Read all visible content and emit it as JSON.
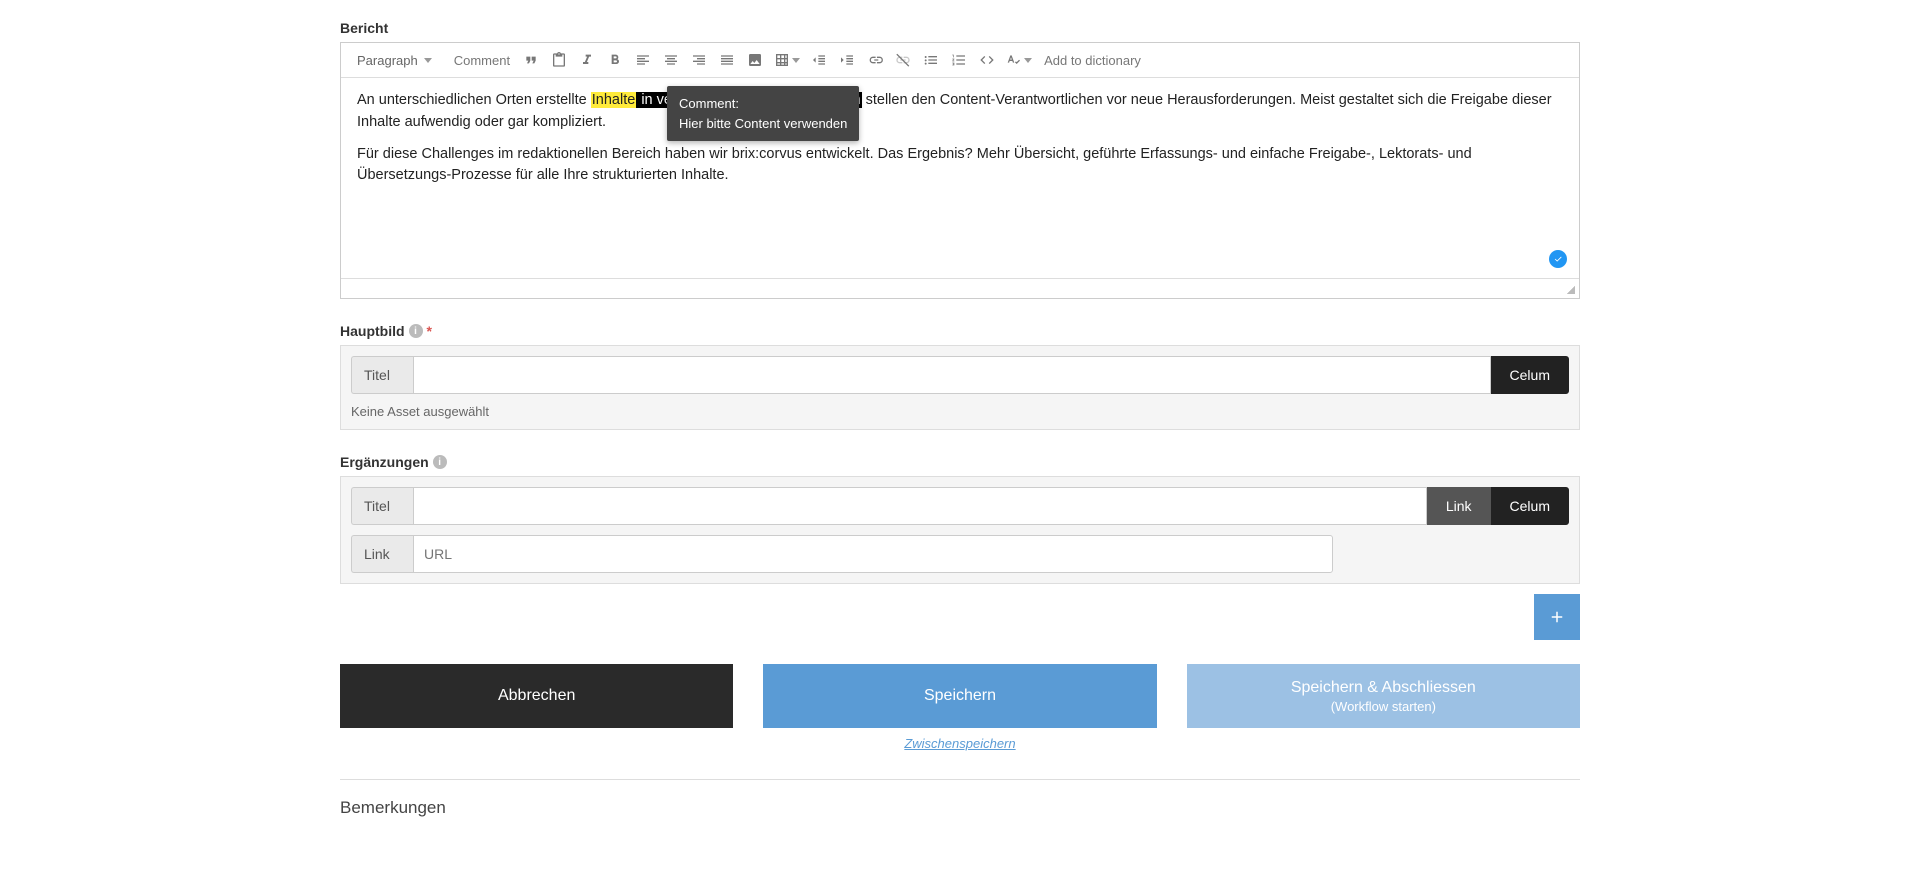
{
  "labels": {
    "bericht": "Bericht",
    "hauptbild": "Hauptbild",
    "erganzungen": "Ergänzungen",
    "bemerkungen": "Bemerkungen"
  },
  "toolbar": {
    "paragraph": "Paragraph",
    "comment": "Comment",
    "add_dict": "Add to dictionary"
  },
  "editor": {
    "p1_a": "An unterschiedlichen Orten erstellte ",
    "p1_hl": "Inhalte",
    "p1_b": " in verschiedenen Sprachvarianten",
    "p1_c": " stellen den Content-Verantwortlichen vor neue Herausforderungen. Meist gestaltet sich die Freigabe dieser Inhalte aufwendig oder gar kompliziert.",
    "p2": "Für diese Challenges im redaktionellen Bereich haben wir brix:corvus entwickelt. Das Ergebnis? Mehr Übersicht, geführte Erfassungs- und einfache Freigabe-, Lektorats- und Übersetzungs-Prozesse für alle Ihre strukturierten Inhalte."
  },
  "tooltip": {
    "line1": "Comment:",
    "line2": "Hier bitte Content verwenden"
  },
  "hauptbild": {
    "titel_addon": "Titel",
    "celum": "Celum",
    "no_asset": "Keine Asset ausgewählt"
  },
  "erganz": {
    "titel_addon": "Titel",
    "link_btn": "Link",
    "celum": "Celum",
    "link_addon": "Link",
    "url_placeholder": "URL"
  },
  "actions": {
    "cancel": "Abbrechen",
    "save": "Speichern",
    "autosave": "Zwischenspeichern",
    "finish": "Speichern & Abschliessen",
    "finish_sub": "(Workflow starten)"
  }
}
